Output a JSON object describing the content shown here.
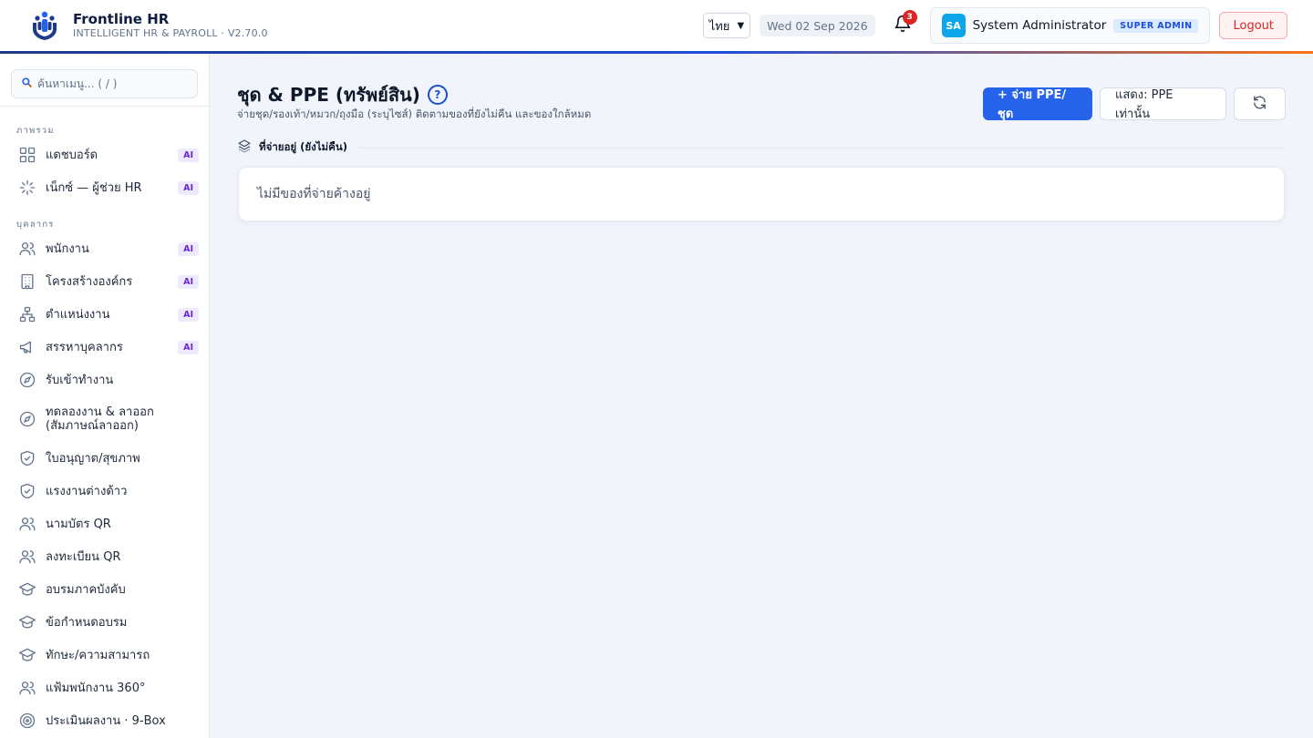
{
  "header": {
    "brand_name": "Frontline HR",
    "brand_sub": "INTELLIGENT HR & PAYROLL · V2.70.0",
    "language": "ไทย",
    "date": "Wed 02 Sep 2026",
    "notification_count": "3",
    "avatar_initials": "SA",
    "user_name": "System Administrator",
    "role": "SUPER ADMIN",
    "logout_label": "Logout",
    "accent_gradient": [
      "#1e3a8a",
      "#1d4ed8",
      "#f97316"
    ]
  },
  "sidebar": {
    "search_placeholder": "ค้นหาเมนู... ( / )",
    "groups": [
      {
        "label": "ภาพรวม"
      },
      {
        "label": "บุคลากร"
      }
    ],
    "items": [
      {
        "label": "แดชบอร์ด",
        "icon": "grid-icon",
        "badge": "AI"
      },
      {
        "label": "เน็กซ์ — ผู้ช่วย HR",
        "icon": "sparkle-icon",
        "badge": "AI"
      },
      {
        "label": "พนักงาน",
        "icon": "users-icon",
        "badge": "AI"
      },
      {
        "label": "โครงสร้างองค์กร",
        "icon": "building-icon",
        "badge": "AI"
      },
      {
        "label": "ตำแหน่งงาน",
        "icon": "org-chart-icon",
        "badge": "AI"
      },
      {
        "label": "สรรหาบุคลากร",
        "icon": "megaphone-icon",
        "badge": "AI"
      },
      {
        "label": "รับเข้าทำงาน",
        "icon": "compass-icon"
      },
      {
        "label": "ทดลองงาน & ลาออก",
        "label2": "(สัมภาษณ์ลาออก)",
        "icon": "compass-icon"
      },
      {
        "label": "ใบอนุญาต/สุขภาพ",
        "icon": "shield-check-icon"
      },
      {
        "label": "แรงงานต่างด้าว",
        "icon": "shield-check-icon"
      },
      {
        "label": "นามบัตร QR",
        "icon": "users-icon"
      },
      {
        "label": "ลงทะเบียน QR",
        "icon": "users-icon"
      },
      {
        "label": "อบรมภาคบังคับ",
        "icon": "graduation-cap-icon"
      },
      {
        "label": "ข้อกำหนดอบรม",
        "icon": "graduation-cap-icon"
      },
      {
        "label": "ทักษะ/ความสามารถ",
        "icon": "graduation-cap-icon"
      },
      {
        "label": "แฟ้มพนักงาน 360°",
        "icon": "users-icon"
      },
      {
        "label": "ประเมินผลงาน · 9-Box",
        "icon": "target-icon"
      }
    ]
  },
  "main": {
    "title": "ชุด & PPE (ทรัพย์สิน)",
    "subtitle": "จ่ายชุด/รองเท้า/หมวก/ถุงมือ (ระบุไซส์) ติดตามของที่ยังไม่คืน และของใกล้หมด",
    "issue_button": "+ จ่าย PPE/ชุด",
    "filter_button": "แสดง: PPE เท่านั้น",
    "section_title": "ที่จ่ายอยู่ (ยังไม่คืน)",
    "empty_message": "ไม่มีของที่จ่ายค้างอยู่",
    "primary_color": "#2563eb"
  }
}
